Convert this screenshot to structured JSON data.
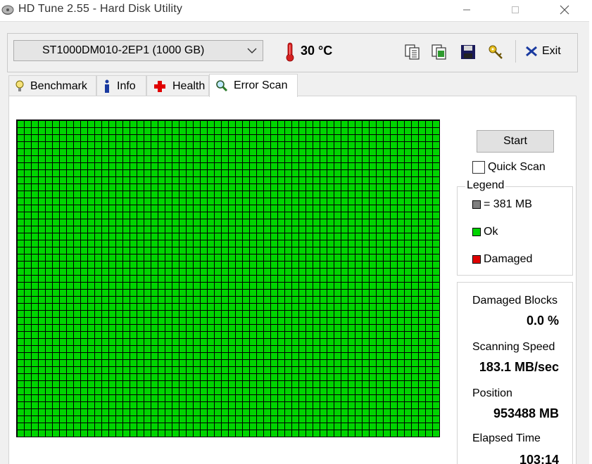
{
  "window": {
    "title": "HD Tune 2.55 - Hard Disk Utility"
  },
  "toolbar": {
    "drive": "ST1000DM010-2EP1 (1000 GB)",
    "temperature": "30 °C",
    "exit_label": "Exit"
  },
  "tabs": [
    {
      "label": "Benchmark",
      "icon": "lightbulb-icon"
    },
    {
      "label": "Info",
      "icon": "info-icon"
    },
    {
      "label": "Health",
      "icon": "health-cross-icon"
    },
    {
      "label": "Error Scan",
      "icon": "magnifier-icon",
      "active": true
    }
  ],
  "scan": {
    "start_label": "Start",
    "quick_scan_label": "Quick Scan",
    "quick_scan_checked": false
  },
  "legend": {
    "title": "Legend",
    "block_size": "= 381 MB",
    "ok": "Ok",
    "damaged": "Damaged"
  },
  "stats": {
    "damaged_blocks_label": "Damaged Blocks",
    "damaged_blocks_value": "0.0 %",
    "scanning_speed_label": "Scanning Speed",
    "scanning_speed_value": "183.1 MB/sec",
    "position_label": "Position",
    "position_value": "953488 MB",
    "elapsed_time_label": "Elapsed Time",
    "elapsed_time_value": "103:14"
  },
  "colors": {
    "ok_block": "#00d400",
    "damaged_block": "#e00000",
    "block_size_swatch": "#808080"
  }
}
